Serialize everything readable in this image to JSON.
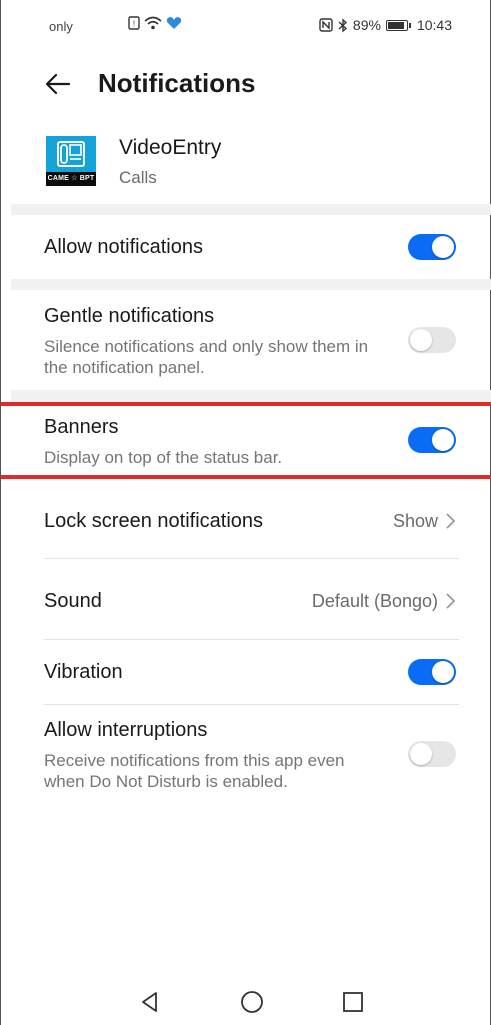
{
  "status_bar": {
    "carrier": "only",
    "battery_percent": "89%",
    "time": "10:43"
  },
  "header": {
    "title": "Notifications"
  },
  "app": {
    "name": "VideoEntry",
    "category": "Calls",
    "icon_brand": "CAME ☆ BPT",
    "icon_color": "#13a3d9"
  },
  "settings": {
    "allow_notifications": {
      "label": "Allow notifications",
      "enabled": true
    },
    "gentle_notifications": {
      "label": "Gentle notifications",
      "description": "Silence notifications and only show them in the notification panel.",
      "enabled": false
    },
    "banners": {
      "label": "Banners",
      "description": "Display on top of the status bar.",
      "enabled": true
    },
    "lock_screen": {
      "label": "Lock screen notifications",
      "value": "Show"
    },
    "sound": {
      "label": "Sound",
      "value": "Default (Bongo)"
    },
    "vibration": {
      "label": "Vibration",
      "enabled": true
    },
    "allow_interruptions": {
      "label": "Allow interruptions",
      "description": "Receive notifications from this app even when Do Not Disturb is enabled.",
      "enabled": false
    }
  },
  "colors": {
    "accent": "#0a6cf5",
    "highlight": "#e02b2b"
  },
  "nav": {
    "back": "back-triangle-icon",
    "home": "home-circle-icon",
    "recents": "recents-square-icon"
  }
}
